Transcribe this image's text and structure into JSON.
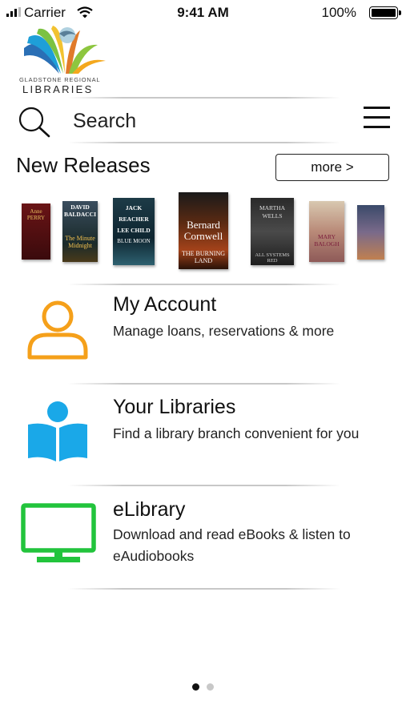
{
  "status": {
    "carrier": "Carrier",
    "time": "9:41 AM",
    "battery": "100%"
  },
  "logo": {
    "line1": "GLADSTONE REGIONAL",
    "line2": "LIBRARIES"
  },
  "search": {
    "placeholder": "Search"
  },
  "new_releases": {
    "title": "New Releases",
    "more_label": "more >",
    "books": [
      {
        "author": "Anne PERRY",
        "title": ""
      },
      {
        "author": "DAVID BALDACCI",
        "title": "The Minute Midnight"
      },
      {
        "author": "JACK REACHER LEE CHILD",
        "title": "BLUE MOON"
      },
      {
        "author": "Bernard Cornwell",
        "title": "THE BURNING LAND"
      },
      {
        "author": "MARTHA WELLS",
        "title": "ALL SYSTEMS RED"
      },
      {
        "author": "MARY BALOGH",
        "title": ""
      },
      {
        "author": "",
        "title": ""
      }
    ]
  },
  "menu": [
    {
      "title": "My Account",
      "subtitle": "Manage loans, reservations & more",
      "icon": "person-icon",
      "color": "#F5A01A"
    },
    {
      "title": "Your Libraries",
      "subtitle": "Find a library branch convenient for you",
      "icon": "reader-book-icon",
      "color": "#1AA8E8"
    },
    {
      "title": "eLibrary",
      "subtitle": "Download and read eBooks & listen to eAudiobooks",
      "icon": "monitor-icon",
      "color": "#22C43C"
    }
  ],
  "pager": {
    "pages": 2,
    "current": 1
  },
  "colors": {
    "accent_orange": "#F5A01A",
    "accent_blue": "#1AA8E8",
    "accent_green": "#22C43C"
  }
}
